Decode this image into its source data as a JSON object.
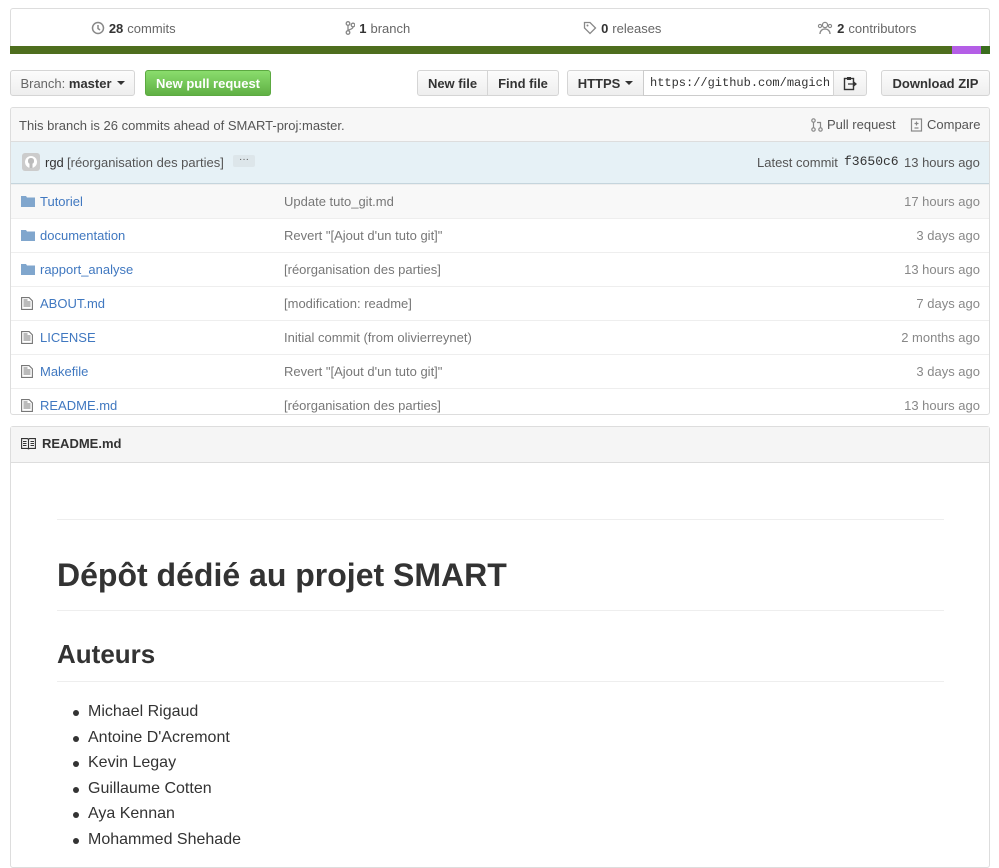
{
  "summary": {
    "commits": {
      "count": "28",
      "label": "commits"
    },
    "branches": {
      "count": "1",
      "label": "branch"
    },
    "releases": {
      "count": "0",
      "label": "releases"
    },
    "contributors": {
      "count": "2",
      "label": "contributors"
    }
  },
  "language_colors": [
    "#4e6e1e",
    "#b45ee6",
    "#3b6e1e"
  ],
  "toolbar": {
    "branch_prefix": "Branch:",
    "branch_name": "master",
    "new_pr": "New pull request",
    "new_file": "New file",
    "find_file": "Find file",
    "protocol": "HTTPS",
    "clone_url": "https://github.com/magich",
    "download_zip": "Download ZIP"
  },
  "branch_info": {
    "text": "This branch is 26 commits ahead of SMART-proj:master.",
    "pull_request": "Pull request",
    "compare": "Compare"
  },
  "latest_commit": {
    "author": "rgd",
    "message": "[réorganisation des parties]",
    "ellipsis": "···",
    "prefix": "Latest commit",
    "sha": "f3650c6",
    "age": "13 hours ago"
  },
  "files": [
    {
      "name": "Tutoriel",
      "type": "dir",
      "message": "Update tuto_git.md",
      "age": "17 hours ago"
    },
    {
      "name": "documentation",
      "type": "dir",
      "message": "Revert \"[Ajout d'un tuto git]\"",
      "age": "3 days ago"
    },
    {
      "name": "rapport_analyse",
      "type": "dir",
      "message": "[réorganisation des parties]",
      "age": "13 hours ago"
    },
    {
      "name": "ABOUT.md",
      "type": "file",
      "message": "[modification: readme]",
      "age": "7 days ago"
    },
    {
      "name": "LICENSE",
      "type": "file",
      "message": "Initial commit (from olivierreynet)",
      "age": "2 months ago"
    },
    {
      "name": "Makefile",
      "type": "file",
      "message": "Revert \"[Ajout d'un tuto git]\"",
      "age": "3 days ago"
    },
    {
      "name": "README.md",
      "type": "file",
      "message": "[réorganisation des parties]",
      "age": "13 hours ago"
    }
  ],
  "readme": {
    "header": "README.md",
    "title": "Dépôt dédié au projet SMART",
    "authors_heading": "Auteurs",
    "authors": [
      "Michael Rigaud",
      "Antoine D'Acremont",
      "Kevin Legay",
      "Guillaume Cotten",
      "Aya Kennan",
      "Mohammed Shehade"
    ]
  }
}
